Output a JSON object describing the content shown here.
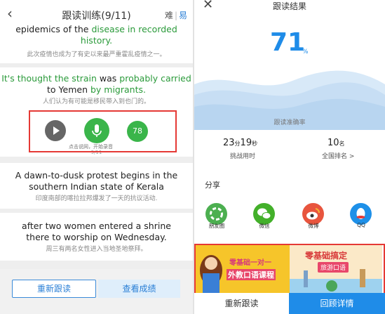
{
  "left": {
    "header": {
      "back_icon": "chevron-left-icon",
      "title": "跟读训练(9/11)",
      "hard": "难",
      "separator": "|",
      "easy": "易"
    },
    "top_card": {
      "en_line1_black": "epidemics of the",
      "en_line1_green": " disease in recorded",
      "en_line2_green": "history.",
      "zh": "此次疫情也成为了有史以来最严重霍乱疫情之一。"
    },
    "active": {
      "en_green1": "It's thought the strain ",
      "en_black1": "was",
      "en_green2": " probably carried",
      "en_black2": "to Yemen",
      "en_green3": " by migrants.",
      "zh": "人们认为有可能是移民带入到也门的。",
      "record_hint": "点击说网，开始录音",
      "progress": "9/11",
      "score": "78"
    },
    "card2": {
      "en": "A dawn-to-dusk protest begins in the southern Indian state of Kerala",
      "zh": "印度南部的喀拉拉邦爆发了一天的抗议活动."
    },
    "card3": {
      "en": "after two women entered a shrine there to worship on Wednesday.",
      "zh": "周三有两名女性进入当地圣地祭拜。"
    },
    "buttons": {
      "retry": "重新跟读",
      "results": "查看成绩"
    }
  },
  "right": {
    "header": {
      "close_icon": "close-icon",
      "title": "跟读结果"
    },
    "score": {
      "value": "71",
      "unit": "%",
      "label": "跟读准确率"
    },
    "time": {
      "min": "23",
      "min_unit": "分",
      "sec": "19",
      "sec_unit": "秒",
      "label": "挑战用时"
    },
    "rank": {
      "value": "10",
      "unit": "名",
      "label": "全国排名 >"
    },
    "share": {
      "title": "分享",
      "items": [
        {
          "label": "朋友圈",
          "icon": "moments-icon",
          "color": "#4caf50"
        },
        {
          "label": "微信",
          "icon": "wechat-icon",
          "color": "#43b02a"
        },
        {
          "label": "微博",
          "icon": "weibo-icon",
          "color": "#e8553e"
        },
        {
          "label": "QQ",
          "icon": "qq-icon",
          "color": "#1e90e8"
        }
      ]
    },
    "banner": {
      "left_line1": "零基础一对一",
      "left_line2": "外教口语课程",
      "right_line1": "零基础搞定",
      "right_line2": "旅游口语"
    },
    "buttons": {
      "retry": "重新跟读",
      "detail": "回顾详情"
    }
  },
  "colors": {
    "accent": "#1f8ce8",
    "green": "#2a9a3a",
    "highlight": "#e53935"
  }
}
